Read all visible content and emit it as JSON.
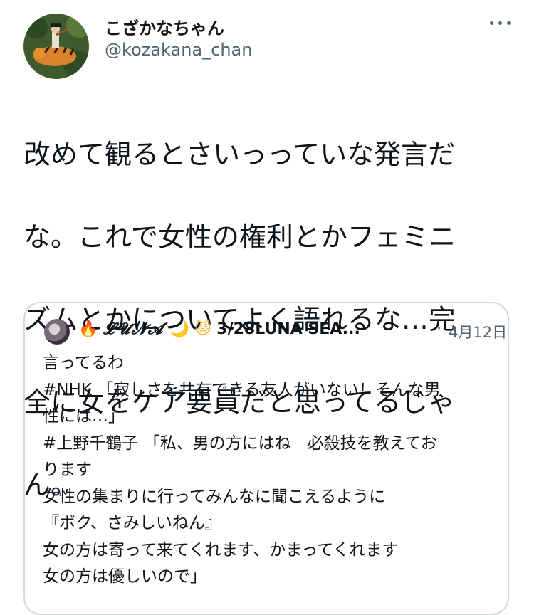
{
  "author": {
    "display_name": "こざかなちゃん",
    "handle": "@kozakana_chan",
    "avatar_icon": "tiger-illustration-avatar"
  },
  "more_icon": "more-horizontal-icon",
  "tweet": {
    "lines": [
      "改めて観るとさいっっていな発言だ",
      "な。これで女性の権利とかフェミニ",
      "ズムとかについてよく語れるな…完",
      "全に女をケア要員だと思ってるじゃ",
      "ん。"
    ]
  },
  "quoted": {
    "name_prefix": "🔥",
    "name_script": "𝓛𝓤𝓝𝓐",
    "name_moon": "🌙",
    "name_cat": "😾",
    "name_text": "3/28LUNA SEA...",
    "separator": "·",
    "date": "4月12日",
    "lines": [
      "言ってるわ",
      "#NHK 「寂しさを共有できる友人がいない！そんな男",
      "性には…」",
      "#上野千鶴子 「私、男の方にはね　必殺技を教えてお",
      "ります",
      "女性の集まりに行ってみんなに聞こえるように",
      "『ボク、さみしいねん』",
      "女の方は寄って来てくれます、かまってくれます",
      "女の方は優しいので」"
    ]
  },
  "colors": {
    "text": "#0f1419",
    "secondary": "#536471",
    "border": "#cfd9de"
  }
}
